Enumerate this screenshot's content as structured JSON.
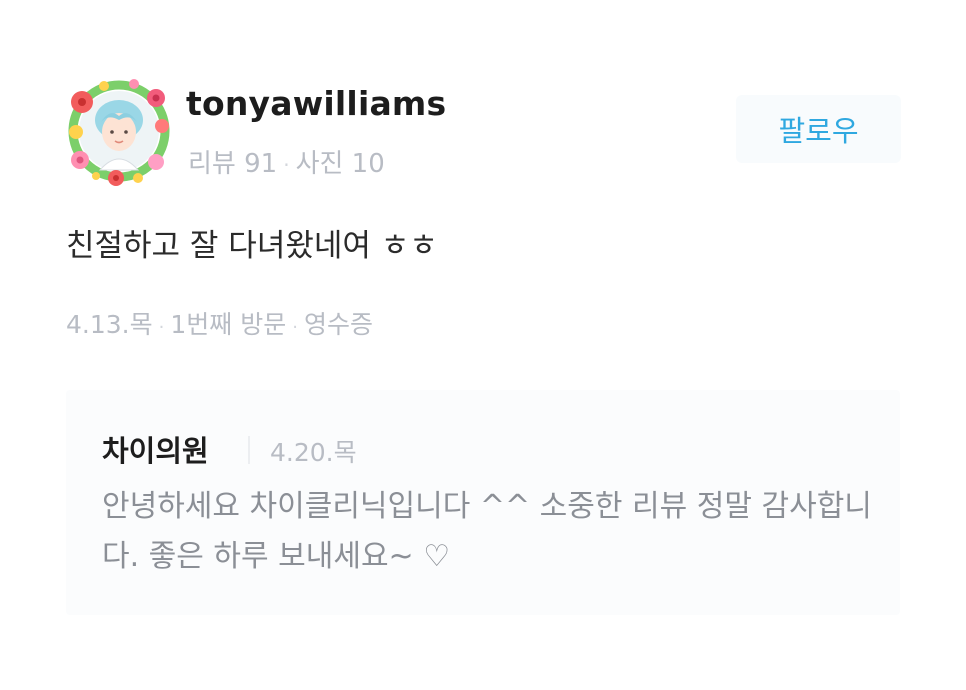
{
  "reviewer": {
    "username": "tonyawilliams",
    "review_count": "리뷰 91",
    "photo_count": "사진 10",
    "follow_label": "팔로우"
  },
  "review": {
    "text": "친절하고 잘 다녀왔네여 ㅎㅎ",
    "date": "4.13.목",
    "visit": "1번째 방문",
    "verification": "영수증"
  },
  "reply": {
    "owner": "차이의원",
    "date": "4.20.목",
    "text": "안녕하세요 차이클리닉입니다 ^^ 소중한 리뷰 정말 감사합니다. 좋은 하루 보내세요~ ♡"
  },
  "colors": {
    "accent": "#2fa8e0",
    "muted": "#b8bcc4",
    "text": "#2b2b2b",
    "reply_text": "#8b8f96",
    "reply_bg": "#fbfcfd"
  },
  "icons": {
    "avatar": "flower-wreath-avatar-icon",
    "separator": "dot-separator"
  }
}
